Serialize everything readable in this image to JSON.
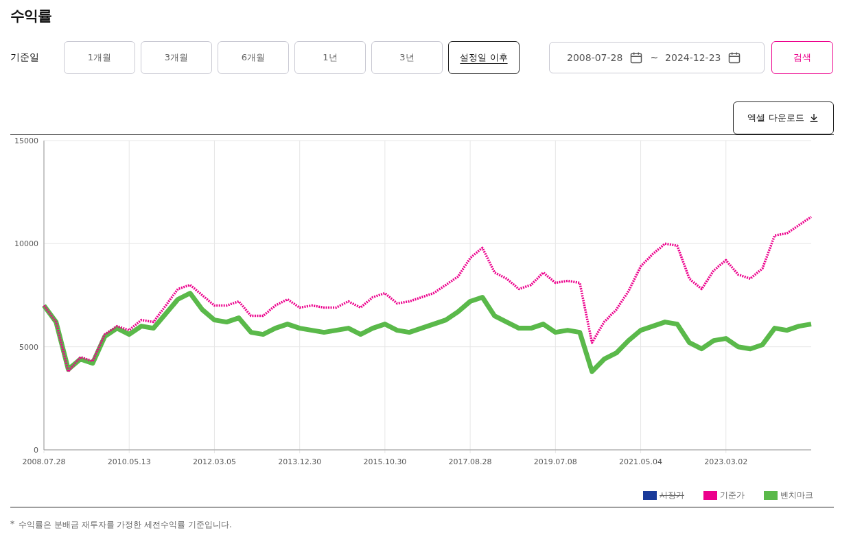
{
  "title": "수익률",
  "filter": {
    "label": "기준일",
    "periods": [
      {
        "label": "1개월",
        "selected": false
      },
      {
        "label": "3개월",
        "selected": false
      },
      {
        "label": "6개월",
        "selected": false
      },
      {
        "label": "1년",
        "selected": false
      },
      {
        "label": "3년",
        "selected": false
      },
      {
        "label": "설정일 이후",
        "selected": true
      }
    ],
    "start_date": "2008-07-28",
    "separator": "~",
    "end_date": "2024-12-23",
    "search_button": "검색"
  },
  "download_button": "엑셀 다운로드",
  "chart": {
    "chart_data": {
      "type": "line",
      "grid": true,
      "ylim": [
        0,
        15000
      ],
      "yticks": [
        0,
        5000,
        10000,
        15000
      ],
      "categories": [
        "2008.07.28",
        null,
        null,
        null,
        null,
        null,
        null,
        "2010.05.13",
        null,
        null,
        null,
        null,
        null,
        null,
        "2012.03.05",
        null,
        null,
        null,
        null,
        null,
        null,
        "2013.12.30",
        null,
        null,
        null,
        null,
        null,
        null,
        "2015.10.30",
        null,
        null,
        null,
        null,
        null,
        null,
        "2017.08.28",
        null,
        null,
        null,
        null,
        null,
        null,
        "2019.07.08",
        null,
        null,
        null,
        null,
        null,
        null,
        "2021.05.04",
        null,
        null,
        null,
        null,
        null,
        null,
        "2023.03.02",
        null,
        null,
        null,
        null,
        null,
        null,
        null
      ],
      "series": [
        {
          "name": "기준가",
          "color": "#ec008c",
          "line_style": "dotted",
          "values": [
            7000,
            6200,
            3800,
            4500,
            4300,
            5600,
            6000,
            5800,
            6300,
            6200,
            7000,
            7800,
            8000,
            7500,
            7000,
            7000,
            7200,
            6500,
            6500,
            7000,
            7300,
            6900,
            7000,
            6900,
            6900,
            7200,
            6900,
            7400,
            7600,
            7100,
            7200,
            7400,
            7600,
            8000,
            8400,
            9300,
            9800,
            8600,
            8300,
            7800,
            8000,
            8600,
            8100,
            8200,
            8100,
            5200,
            6200,
            6800,
            7700,
            8900,
            9500,
            10000,
            9900,
            8300,
            7800,
            8700,
            9200,
            8500,
            8300,
            8800,
            10400,
            10500,
            10900,
            11300
          ]
        },
        {
          "name": "벤치마크",
          "color": "#5ab94a",
          "line_style": "solid",
          "values": [
            7000,
            6200,
            3900,
            4400,
            4200,
            5500,
            5900,
            5600,
            6000,
            5900,
            6600,
            7300,
            7600,
            6800,
            6300,
            6200,
            6400,
            5700,
            5600,
            5900,
            6100,
            5900,
            5800,
            5700,
            5800,
            5900,
            5600,
            5900,
            6100,
            5800,
            5700,
            5900,
            6100,
            6300,
            6700,
            7200,
            7400,
            6500,
            6200,
            5900,
            5900,
            6100,
            5700,
            5800,
            5700,
            3800,
            4400,
            4700,
            5300,
            5800,
            6000,
            6200,
            6100,
            5200,
            4900,
            5300,
            5400,
            5000,
            4900,
            5100,
            5900,
            5800,
            6000,
            6100
          ]
        }
      ]
    }
  },
  "legend": [
    {
      "label": "시장가",
      "color": "#1a3a9a",
      "hidden": true
    }
  ],
  "footnote_mark": "*",
  "footnote": "수익률은 분배금 재투자를 가정한 세전수익률 기준입니다."
}
